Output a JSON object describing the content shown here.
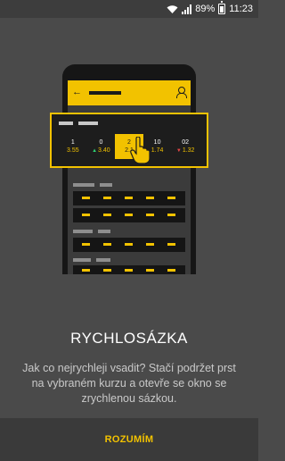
{
  "status_bar": {
    "battery_percent": "89%",
    "time": "11:23",
    "icons": [
      "wifi-icon",
      "signal-icon",
      "battery-charging-icon"
    ]
  },
  "illustration": {
    "odds": [
      {
        "label": "1",
        "value": "3.55",
        "trend": "none"
      },
      {
        "label": "0",
        "value": "3.40",
        "trend": "up"
      },
      {
        "label": "2",
        "value": "2.1",
        "trend": "none",
        "selected": true
      },
      {
        "label": "10",
        "value": "1.74",
        "trend": "none"
      },
      {
        "label": "02",
        "value": "1.32",
        "trend": "down"
      }
    ],
    "icons": [
      "back-arrow-icon",
      "user-icon",
      "hand-pointer-icon"
    ]
  },
  "onboarding": {
    "title": "RYCHLOSÁZKA",
    "description": "Jak co nejrychleji vsadit? Stačí podržet prst na vybraném kurzu a otevře se okno se zrychlenou sázkou."
  },
  "footer": {
    "button_label": "ROZUMÍM"
  },
  "colors": {
    "accent": "#f2c200",
    "background": "#4a4a4a",
    "footer_bg": "#3a3a3a"
  }
}
